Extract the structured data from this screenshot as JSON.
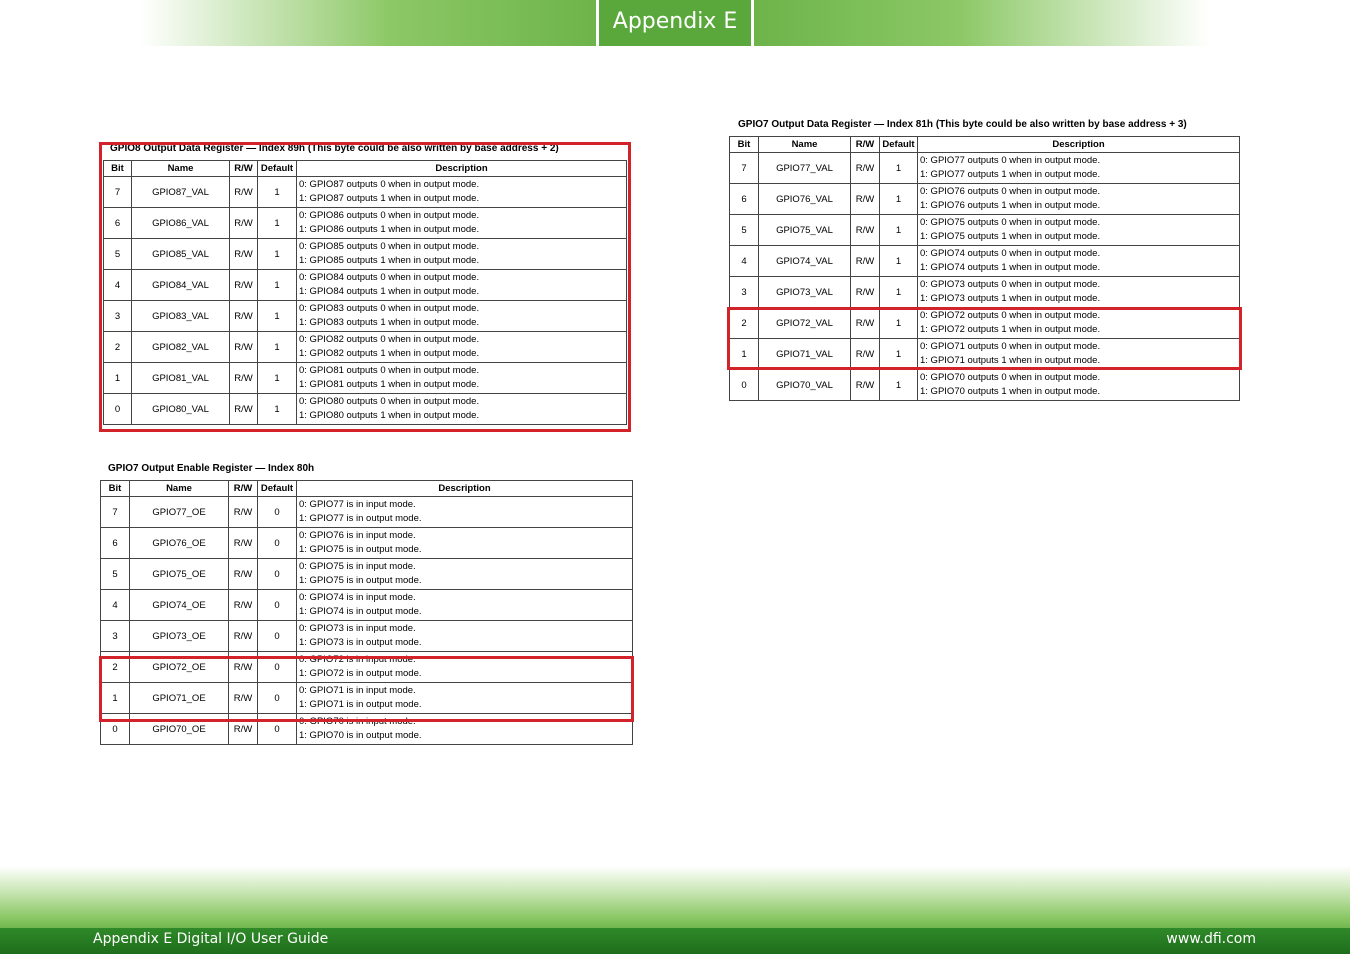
{
  "header": {
    "title": "Appendix E"
  },
  "footer": {
    "left": "Appendix E Digital I/O User Guide",
    "right": "www.dfi.com"
  },
  "columns": {
    "bit": "Bit",
    "name": "Name",
    "rw": "R/W",
    "default": "Default",
    "description": "Description"
  },
  "tables": {
    "gpio8_data": {
      "caption": "GPIO8 Output Data Register — Index 89h (This byte could be also written by base address + 2)",
      "rows": [
        {
          "bit": "7",
          "name": "GPIO87_VAL",
          "rw": "R/W",
          "default": "1",
          "d0": "0: GPIO87 outputs 0 when in output mode.",
          "d1": "1: GPIO87 outputs 1 when in output mode."
        },
        {
          "bit": "6",
          "name": "GPIO86_VAL",
          "rw": "R/W",
          "default": "1",
          "d0": "0: GPIO86 outputs 0 when in output mode.",
          "d1": "1: GPIO86 outputs 1 when in output mode."
        },
        {
          "bit": "5",
          "name": "GPIO85_VAL",
          "rw": "R/W",
          "default": "1",
          "d0": "0: GPIO85 outputs 0 when in output mode.",
          "d1": "1: GPIO85 outputs 1 when in output mode."
        },
        {
          "bit": "4",
          "name": "GPIO84_VAL",
          "rw": "R/W",
          "default": "1",
          "d0": "0: GPIO84 outputs 0 when in output mode.",
          "d1": "1: GPIO84 outputs 1 when in output mode."
        },
        {
          "bit": "3",
          "name": "GPIO83_VAL",
          "rw": "R/W",
          "default": "1",
          "d0": "0: GPIO83 outputs 0 when in output mode.",
          "d1": "1: GPIO83 outputs 1 when in output mode."
        },
        {
          "bit": "2",
          "name": "GPIO82_VAL",
          "rw": "R/W",
          "default": "1",
          "d0": "0: GPIO82 outputs 0 when in output mode.",
          "d1": "1: GPIO82 outputs 1 when in output mode."
        },
        {
          "bit": "1",
          "name": "GPIO81_VAL",
          "rw": "R/W",
          "default": "1",
          "d0": "0: GPIO81 outputs 0 when in output mode.",
          "d1": "1: GPIO81 outputs 1 when in output mode."
        },
        {
          "bit": "0",
          "name": "GPIO80_VAL",
          "rw": "R/W",
          "default": "1",
          "d0": "0: GPIO80 outputs 0 when in output mode.",
          "d1": "1: GPIO80 outputs 1 when in output mode."
        }
      ]
    },
    "gpio7_enable": {
      "caption": "GPIO7 Output Enable Register — Index 80h",
      "rows": [
        {
          "bit": "7",
          "name": "GPIO77_OE",
          "rw": "R/W",
          "default": "0",
          "d0": "0: GPIO77 is in input mode.",
          "d1": "1: GPIO77 is in output mode."
        },
        {
          "bit": "6",
          "name": "GPIO76_OE",
          "rw": "R/W",
          "default": "0",
          "d0": "0: GPIO76 is in input mode.",
          "d1": "1: GPIO75 is in output mode."
        },
        {
          "bit": "5",
          "name": "GPIO75_OE",
          "rw": "R/W",
          "default": "0",
          "d0": "0: GPIO75 is in input mode.",
          "d1": "1: GPIO75 is in output mode."
        },
        {
          "bit": "4",
          "name": "GPIO74_OE",
          "rw": "R/W",
          "default": "0",
          "d0": "0: GPIO74 is in input mode.",
          "d1": "1: GPIO74 is in output mode."
        },
        {
          "bit": "3",
          "name": "GPIO73_OE",
          "rw": "R/W",
          "default": "0",
          "d0": "0: GPIO73 is in input mode.",
          "d1": "1: GPIO73 is in output mode."
        },
        {
          "bit": "2",
          "name": "GPIO72_OE",
          "rw": "R/W",
          "default": "0",
          "d0": "0: GPIO72 is in input mode.",
          "d1": "1: GPIO72 is in output mode."
        },
        {
          "bit": "1",
          "name": "GPIO71_OE",
          "rw": "R/W",
          "default": "0",
          "d0": "0: GPIO71 is in input mode.",
          "d1": "1: GPIO71 is in output mode."
        },
        {
          "bit": "0",
          "name": "GPIO70_OE",
          "rw": "R/W",
          "default": "0",
          "d0": "0: GPIO70 is in input mode.",
          "d1": "1: GPIO70 is in output mode."
        }
      ]
    },
    "gpio7_data": {
      "caption": "GPIO7 Output Data Register — Index 81h (This byte could be also written by base address + 3)",
      "rows": [
        {
          "bit": "7",
          "name": "GPIO77_VAL",
          "rw": "R/W",
          "default": "1",
          "d0": "0: GPIO77 outputs 0 when in output mode.",
          "d1": "1: GPIO77 outputs 1 when in output mode."
        },
        {
          "bit": "6",
          "name": "GPIO76_VAL",
          "rw": "R/W",
          "default": "1",
          "d0": "0: GPIO76 outputs 0 when in output mode.",
          "d1": "1: GPIO76 outputs 1 when in output mode."
        },
        {
          "bit": "5",
          "name": "GPIO75_VAL",
          "rw": "R/W",
          "default": "1",
          "d0": "0: GPIO75 outputs 0 when in output mode.",
          "d1": "1: GPIO75 outputs 1 when in output mode."
        },
        {
          "bit": "4",
          "name": "GPIO74_VAL",
          "rw": "R/W",
          "default": "1",
          "d0": "0: GPIO74 outputs 0 when in output mode.",
          "d1": "1: GPIO74 outputs 1 when in output mode."
        },
        {
          "bit": "3",
          "name": "GPIO73_VAL",
          "rw": "R/W",
          "default": "1",
          "d0": "0: GPIO73 outputs 0 when in output mode.",
          "d1": "1: GPIO73 outputs 1 when in output mode."
        },
        {
          "bit": "2",
          "name": "GPIO72_VAL",
          "rw": "R/W",
          "default": "1",
          "d0": "0: GPIO72 outputs 0 when in output mode.",
          "d1": "1: GPIO72 outputs 1 when in output mode."
        },
        {
          "bit": "1",
          "name": "GPIO71_VAL",
          "rw": "R/W",
          "default": "1",
          "d0": "0: GPIO71 outputs 0 when in output mode.",
          "d1": "1: GPIO71 outputs 1 when in output mode."
        },
        {
          "bit": "0",
          "name": "GPIO70_VAL",
          "rw": "R/W",
          "default": "1",
          "d0": "0: GPIO70 outputs 0 when in output mode.",
          "d1": "1: GPIO70 outputs 1 when in output mode."
        }
      ]
    }
  },
  "highlight_color": "#d2232a"
}
